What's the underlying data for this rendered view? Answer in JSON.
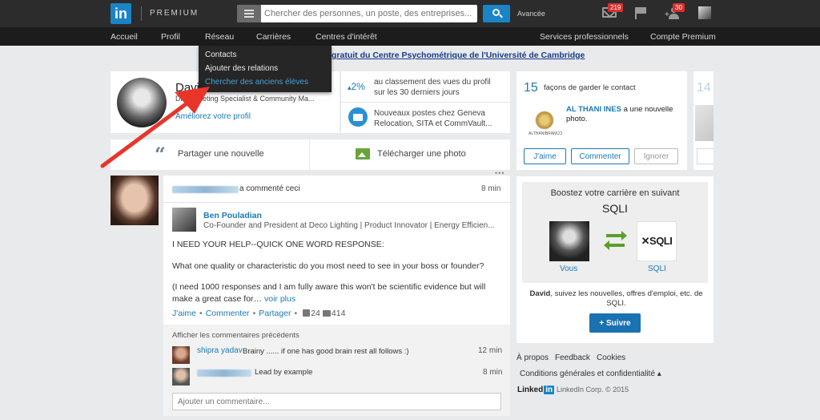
{
  "topbar": {
    "logo_text": "in",
    "premium_label": "PREMIUM",
    "search_placeholder": "Chercher des personnes, un poste, des entreprises...",
    "advanced_label": "Avancée",
    "messages_count": "219",
    "connections_count": "30"
  },
  "nav": {
    "items": [
      "Accueil",
      "Profil",
      "Réseau",
      "Carrières",
      "Centres d'intérêt",
      "Services professionnels",
      "Compte Premium"
    ]
  },
  "dropdown": {
    "items": [
      "Contacts",
      "Ajouter des relations",
      "Chercher des anciens élèves"
    ]
  },
  "banner": {
    "text": "gratuit du Centre Psychométrique de l'Université de Cambridge"
  },
  "profile": {
    "name": "Davi",
    "headline": "Dir    Marketing Specialist & Community Ma...",
    "improve_link": "Améliorez votre profil",
    "stat1_value": "2%",
    "stat1_text": "au classement des vues du profil sur les 30 derniers jours",
    "stat2_text": "Nouveaux postes chez Geneva Relocation, SITA et CommVault..."
  },
  "share": {
    "share_label": "Partager une nouvelle",
    "upload_label": "Télécharger une photo"
  },
  "feed": {
    "commented_text": "a commenté ceci",
    "time": "8 min",
    "author_name": "Ben Pouladian",
    "author_headline": "Co-Founder and President at Deco Lighting | Product Innovator | Energy Efficien...",
    "para1": "I NEED YOUR HELP--QUICK ONE WORD RESPONSE:",
    "para2": "What one quality or characteristic do you most need to see in your boss or founder?",
    "para3": "(I need 1000 responses and I am fully aware this won't be scientific evidence but will make a great case for…",
    "see_more": "voir plus",
    "like_label": "J'aime",
    "comment_label": "Commenter",
    "share_label": "Partager",
    "likes_count": "24",
    "comments_count": "414",
    "show_prev": "Afficher les commentaires précédents",
    "comment1_name": "shipra yadav",
    "comment1_text": "Brainy ...... if one has good brain rest all follows :)",
    "comment1_time": "12 min",
    "comment2_text": "Lead by example",
    "comment2_time": "8 min",
    "add_comment_placeholder": "Ajouter un commentaire..."
  },
  "keep_contact": {
    "number": "15",
    "title": "façons de garder le contact",
    "who_name": "AL THANI INES",
    "who_text": "a une nouvelle photo.",
    "logo_caption": "ALTHANIBRANCO",
    "like_btn": "J'aime",
    "comment_btn": "Commenter",
    "ignore_btn": "Ignorer",
    "peek_number": "14"
  },
  "boost": {
    "line1": "Boostez votre carrière en suivant",
    "line2": "SQLI",
    "logo_text": "✕SQLI",
    "you_label": "Vous",
    "company_label": "SQLI",
    "desc_name": "David",
    "desc": ", suivez les nouvelles, offres d'emploi, etc. de SQLI.",
    "follow_btn": "+ Suivre"
  },
  "footer": {
    "about": "À propos",
    "feedback": "Feedback",
    "cookies": "Cookies",
    "terms": "Conditions générales et confidentialité ▴",
    "logo_word": "Linked",
    "logo_in": "in",
    "corp": "LinkedIn Corp. © 2015"
  },
  "colors": {
    "brand": "#1a84c6",
    "link": "#1b7bb4",
    "annotation_arrow": "#e8352a"
  }
}
